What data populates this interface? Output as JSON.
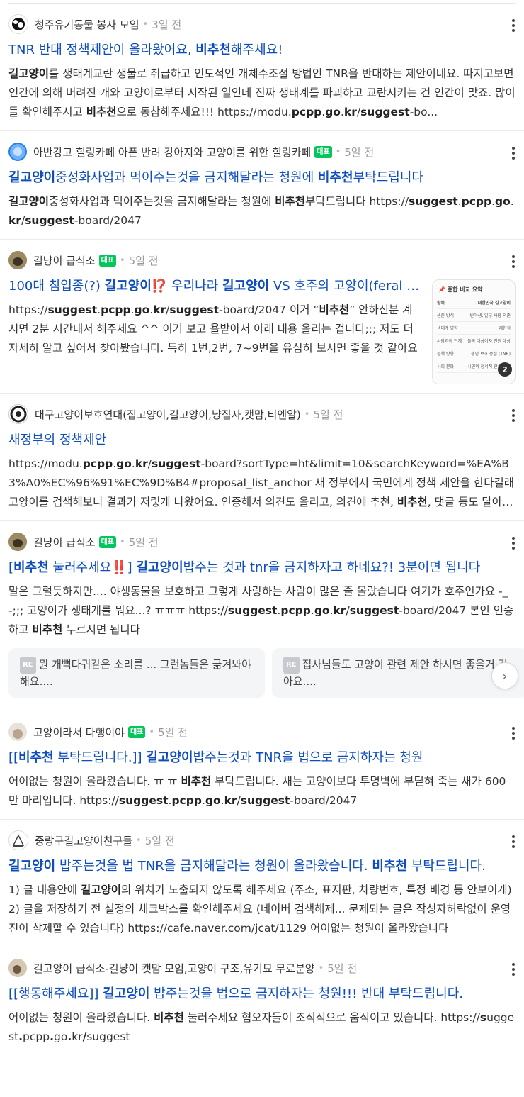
{
  "posts": [
    {
      "source": "청주유기동물 봉사 모임",
      "badge": "",
      "time": "3일 전",
      "title_parts": [
        "TNR 반대 정책제안이 올라왔어요, ",
        "비추천",
        "해주세요!"
      ],
      "desc_parts": [
        "길고양이",
        "를 생태계교란 생물로 취급하고 인도적인 개체수조절 방법인 TNR을 반대하는 제안이네요. 따지고보면 인간에 의해 버려진 개와 고양이로부터 시작된 일인데 진짜 생태계를 파괴하고 교란시키는 건 인간이 맞죠. 많이들 확인해주시고 ",
        "비추천",
        "으로 동참해주세요!!! https://modu.",
        "pcpp",
        ".",
        "go",
        ".",
        "kr",
        "/",
        "suggest",
        "-bo..."
      ]
    },
    {
      "source": "아반강고 힐링카페 아픈 반려 강아지와 고양이를 위한 힐링카페",
      "badge": "대표",
      "time": "5일 전",
      "title_parts": [
        "길고양이",
        "중성화사업과 먹이주는것을 금지해달라는 청원에 ",
        "비추천",
        "부탁드립니다"
      ],
      "desc_parts": [
        "길고양이",
        "중성화사업과 먹이주는것을 금지해달라는 청원에 ",
        "비추천",
        "부탁드립니다 https://",
        "suggest",
        ".",
        "pcpp",
        ".",
        "go",
        ".",
        "kr",
        "/",
        "suggest",
        "-board/2047"
      ]
    },
    {
      "source": "길냥이 급식소",
      "badge": "대표",
      "time": "5일 전",
      "title_parts": [
        "100대 침입종(?) ",
        "길고양이",
        "⁉️",
        " 우리나라 ",
        "길고양이",
        " VS 호주의 고양이(feral cat) 비교"
      ],
      "desc_parts": [
        "https://",
        "suggest",
        ".",
        "pcpp",
        ".",
        "go",
        ".",
        "kr",
        "/",
        "suggest",
        "-board/2047 이거 “",
        "비추천",
        "” 안하신분 계시면 2분 시간내서 해주세요 ^^ 이거 보고 욜받아서 아래 내용 올리는 겁니다;;; 저도 더 자세히 알고 싶어서 찾아봤습니다. 특히 1번,2번, 7~9번을 유심히 보시면 좋을 것 같아요"
      ],
      "thumb": {
        "title": "📌 종합 비교 요약",
        "rows": [
          [
            "항목",
            "대한민국 길고양이"
          ],
          [
            "생존 방식",
            "반야생, 일부 사람 의존"
          ],
          [
            "생태계 영향",
            "제한적"
          ],
          [
            "사람과의 관계",
            "돌봄 대상이자 민원 대상"
          ],
          [
            "정책 방향",
            "생명 보호 중심 (TNR)"
          ],
          [
            "사회 문화",
            "시민의 정서적 관심 대상"
          ]
        ],
        "count": "2"
      }
    },
    {
      "source": "대구고양이보호연대(집고양이,길고양이,냥집사,캣맘,티엔알)",
      "badge": "",
      "time": "5일 전",
      "title_parts": [
        "새정부의 정책제안"
      ],
      "desc_parts": [
        "https://modu.",
        "pcpp",
        ".",
        "go",
        ".",
        "kr",
        "/",
        "suggest",
        "-board?sortType=ht&limit=10&searchKeyword=%EA%B3%A0%EC%96%91%EC%9D%B4#proposal_list_anchor 새 정부에서 국민에게 정책 제안을 한다길래 고양이를 검색해보니 결과가 저렇게 나왔어요. 인증해서 의견도 올리고, 의견에 추천, ",
        "비추천",
        ", 댓글 등도 달아주세요"
      ]
    },
    {
      "source": "길냥이 급식소",
      "badge": "대표",
      "time": "5일 전",
      "title_parts": [
        "[",
        "비추천",
        " 눌러주세요",
        "‼️",
        "] ",
        "길고양이",
        "밥주는 것과 tnr을 금지하자고 하네요?! 3분이면 됩니다"
      ],
      "desc_parts": [
        "말은 그럴듯하지만.... 야생동물을 보호하고 그렇게 사랑하는 사람이 많은 줄 몰랐습니다 여기가 호주인가요 -_-;;; 고양이가 생태계를 뭐요...? ㅠㅠㅠ https://",
        "suggest",
        ".",
        "pcpp",
        ".",
        "go",
        ".",
        "kr",
        "/",
        "suggest",
        "-board/2047 본인 인증하고 ",
        "비추천",
        " 누르시면 됩니다"
      ],
      "replies": [
        {
          "re": "RE",
          "text": "뭔 개뼉다귀같은 소리를 ... 그런놈들은 굶겨봐야해요...."
        },
        {
          "re": "RE",
          "text": "집사님들도 고양이 관련 제안 하시면 좋을거 같아요...."
        }
      ]
    },
    {
      "source": "고양이라서 다행이야",
      "badge": "대표",
      "time": "5일 전",
      "title_parts": [
        "[[",
        "비추천",
        " 부탁드립니다.]] ",
        "길고양이",
        "밥주는것과 TNR을 법으로 금지하자는 청원"
      ],
      "desc_parts": [
        "어이없는 청원이 올라왔습니다. ㅠ ㅠ ",
        "비추천",
        " 부탁드립니다. 새는 고양이보다 투명벽에 부딛혀 죽는 새가 600만 마리입니다. https://",
        "suggest",
        ".",
        "pcpp",
        ".",
        "go",
        ".",
        "kr",
        "/",
        "suggest",
        "-board/2047"
      ]
    },
    {
      "source": "중랑구길고양이친구들",
      "badge": "",
      "time": "5일 전",
      "title_parts": [
        "길고양이",
        " 밥주는것을 법 TNR을 금지해달라는 청원이 올라왔습니다. ",
        "비추천",
        " 부탁드립니다."
      ],
      "desc_parts": [
        "1) 글 내용안에 ",
        "길고양이",
        "의 위치가 노출되지 않도록 해주세요 (주소, 표지판, 차량번호, 특정 배경 등 안보이게) 2) 글을 저장하기 전 설정의 체크박스를 확인해주세요 (네이버 검색해제... 문제되는 글은 작성자허락없이 운영진이 삭제할 수 있습니다) https://cafe.naver.com/jcat/1129 어이없는 청원이 올라왔습니다"
      ]
    },
    {
      "source": "길고양이 급식소-길냥이 캣맘 모임,고양이 구조,유기묘 무료분양",
      "badge": "",
      "time": "5일 전",
      "title_parts": [
        "[[행동해주세요]] ",
        "길고양이",
        " 밥주는것을 법으로 금지하자는 청원!!! 반대 부탁드립니다."
      ],
      "desc_parts": [
        "어이없는 청원이 올라왔습니다. ",
        "비추천",
        " 눌러주세요 혐오자들이 조직적으로 움직이고 있습니다. https://",
        "s",
        "uggest",
        ".",
        "pcpp",
        ".",
        "go",
        ".",
        "kr",
        "/",
        "suggest",
        "-board/2047"
      ]
    }
  ],
  "colors": {
    "title": "#0e4dbd",
    "badge": "#03c75a",
    "text": "#333333",
    "meta": "#999999"
  }
}
